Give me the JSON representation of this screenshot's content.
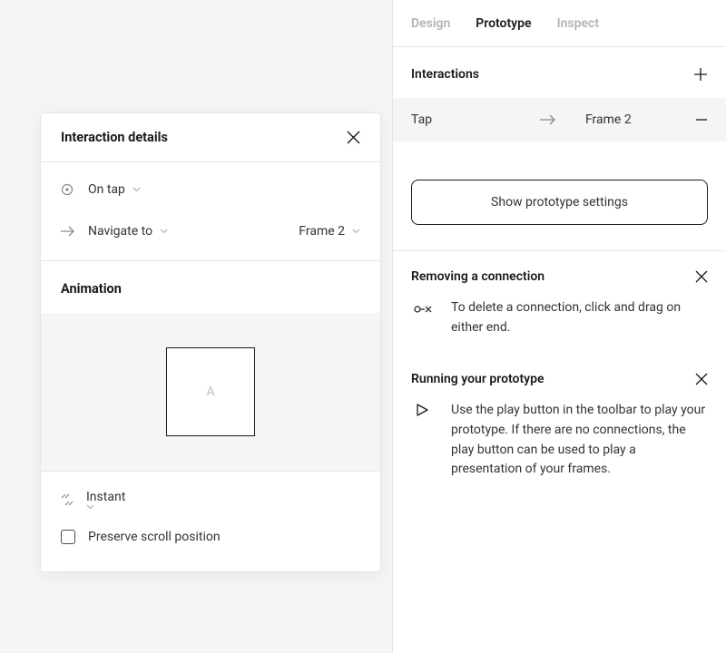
{
  "tabs": {
    "design": "Design",
    "prototype": "Prototype",
    "inspect": "Inspect"
  },
  "interactions": {
    "title": "Interactions",
    "row": {
      "trigger": "Tap",
      "target": "Frame 2"
    }
  },
  "settings_button": "Show prototype settings",
  "tips": {
    "remove": {
      "title": "Removing a connection",
      "text": "To delete a connection, click and drag on either end."
    },
    "run": {
      "title": "Running your prototype",
      "text": "Use the play button in the toolbar to play your prototype. If there are no connections, the play button can be used to play a presentation of your frames."
    }
  },
  "modal": {
    "title": "Interaction details",
    "trigger": "On tap",
    "action": "Navigate to",
    "target": "Frame 2",
    "animation_title": "Animation",
    "preview_label": "A",
    "easing": "Instant",
    "preserve_scroll": "Preserve scroll position"
  }
}
